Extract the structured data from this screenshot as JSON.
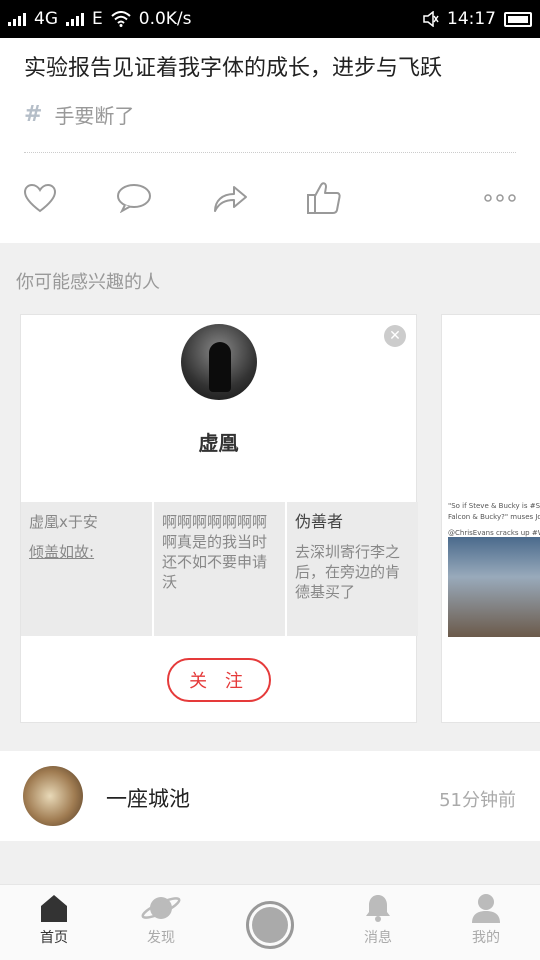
{
  "status_bar": {
    "network": "4G",
    "network2": "E",
    "speed": "0.0K/s",
    "time": "14:17"
  },
  "post": {
    "text": "实验报告见证着我字体的成长，进步与飞跃",
    "topic": "手要断了"
  },
  "section": {
    "title": "你可能感兴趣的人"
  },
  "suggest_card": {
    "name": "虚凰",
    "follow_label": "关 注",
    "cells": [
      {
        "line1": "虚凰x于安",
        "line2": "倾盖如故:"
      },
      {
        "text": "啊啊啊啊啊啊啊啊真是的我当时还不如不要申请沃"
      },
      {
        "title": "伪善者",
        "text": "去深圳寄行李之后，在旁边的肯德基买了"
      }
    ]
  },
  "suggest_card_2": {
    "text_line1": "\"So if Steve & Bucky is #Stucky w",
    "text_line2": "Falcon & Bucky?\" muses Joe Ru",
    "text_line3": "@ChrisEvans cracks up #WizardW"
  },
  "feed": {
    "name": "一座城池",
    "time": "51分钟前"
  },
  "nav": {
    "home": "首页",
    "discover": "发现",
    "messages": "消息",
    "me": "我的"
  },
  "colors": {
    "accent": "#e53a3a",
    "topic_hash": "#b5bec8"
  }
}
